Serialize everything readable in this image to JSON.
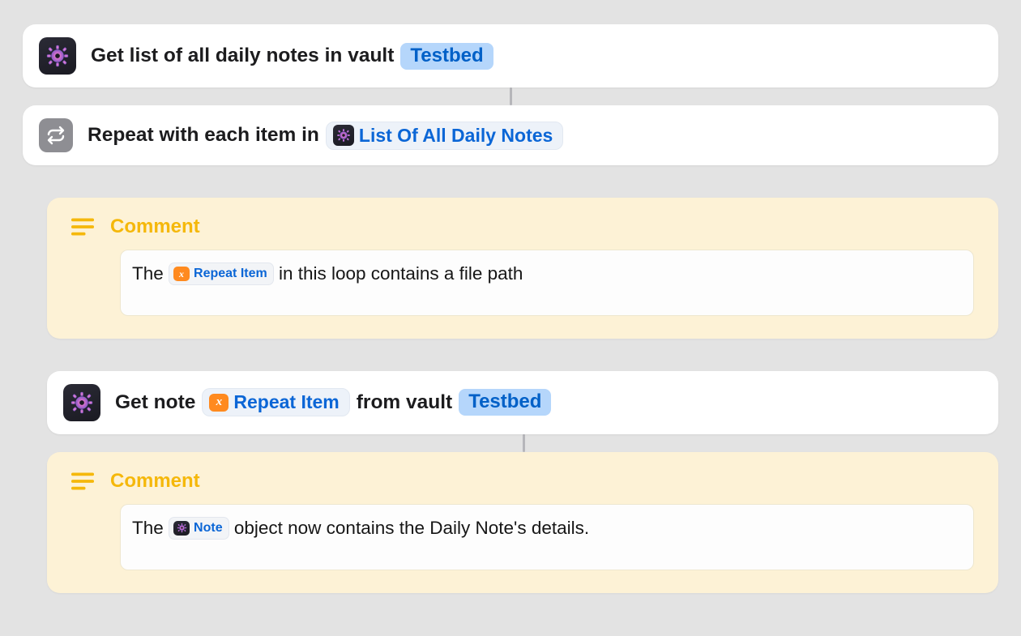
{
  "action1": {
    "prefix": "Get list of all daily notes in vault",
    "vault": "Testbed"
  },
  "action2": {
    "prefix": "Repeat with each item in",
    "var_label": "List Of All Daily Notes"
  },
  "comment1": {
    "title": "Comment",
    "text_before": "The ",
    "token_label": "Repeat Item",
    "text_after": " in this loop contains a file path"
  },
  "action3": {
    "prefix": "Get note",
    "var_label": "Repeat Item",
    "middle": "from vault",
    "vault": "Testbed"
  },
  "comment2": {
    "title": "Comment",
    "text_before": "The ",
    "token_label": "Note",
    "text_after": " object now contains the Daily Note's details."
  }
}
